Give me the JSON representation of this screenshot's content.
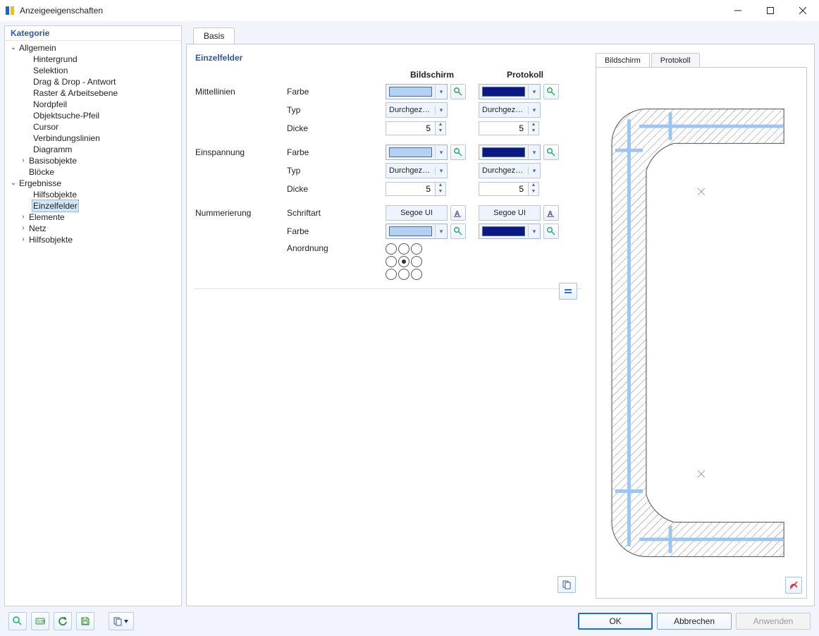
{
  "window": {
    "title": "Anzeigeeigenschaften"
  },
  "sidebar": {
    "header": "Kategorie",
    "items": {
      "allgemein": {
        "label": "Allgemein",
        "expanded": true
      },
      "hintergrund": {
        "label": "Hintergrund"
      },
      "selektion": {
        "label": "Selektion"
      },
      "dragdrop": {
        "label": "Drag & Drop - Antwort"
      },
      "raster": {
        "label": "Raster & Arbeitsebene"
      },
      "nordpfeil": {
        "label": "Nordpfeil"
      },
      "objektsuche": {
        "label": "Objektsuche-Pfeil"
      },
      "cursor": {
        "label": "Cursor"
      },
      "verbindung": {
        "label": "Verbindungslinien"
      },
      "diagramm": {
        "label": "Diagramm"
      },
      "basisobjekte": {
        "label": "Basisobjekte",
        "expanded": false
      },
      "bloecke": {
        "label": "Blöcke"
      },
      "ergebnisse": {
        "label": "Ergebnisse",
        "expanded": true
      },
      "hilfsobjekte_erg": {
        "label": "Hilfsobjekte"
      },
      "einzelfelder": {
        "label": "Einzelfelder",
        "selected": true
      },
      "elemente": {
        "label": "Elemente",
        "expanded": false
      },
      "netz": {
        "label": "Netz",
        "expanded": false
      },
      "hilfsobjekte": {
        "label": "Hilfsobjekte",
        "expanded": false
      }
    }
  },
  "tabs": {
    "basis": "Basis"
  },
  "form": {
    "section": "Einzelfelder",
    "cols": {
      "bildschirm": "Bildschirm",
      "protokoll": "Protokoll"
    },
    "groups": {
      "mittellinien": {
        "title": "Mittellinien",
        "farbe_label": "Farbe",
        "typ_label": "Typ",
        "dicke_label": "Dicke",
        "screen_color": "#b3d1f3",
        "print_color": "#0a1a82",
        "screen_type": "Durchgezo...",
        "print_type": "Durchgezo...",
        "screen_thick": "5",
        "print_thick": "5"
      },
      "einspannung": {
        "title": "Einspannung",
        "farbe_label": "Farbe",
        "typ_label": "Typ",
        "dicke_label": "Dicke",
        "screen_color": "#b3d1f3",
        "print_color": "#0a1a82",
        "screen_type": "Durchgezo...",
        "print_type": "Durchgezo...",
        "screen_thick": "5",
        "print_thick": "5"
      },
      "nummerierung": {
        "title": "Nummerierung",
        "schrift_label": "Schriftart",
        "farbe_label": "Farbe",
        "anordnung_label": "Anordnung",
        "screen_font": "Segoe UI",
        "print_font": "Segoe UI",
        "screen_color": "#b3d1f3",
        "print_color": "#0a1a82",
        "arrangement_selected": 4
      }
    }
  },
  "preview": {
    "tabs": {
      "bildschirm": "Bildschirm",
      "protokoll": "Protokoll"
    }
  },
  "buttons": {
    "ok": "OK",
    "cancel": "Abbrechen",
    "apply": "Anwenden"
  }
}
